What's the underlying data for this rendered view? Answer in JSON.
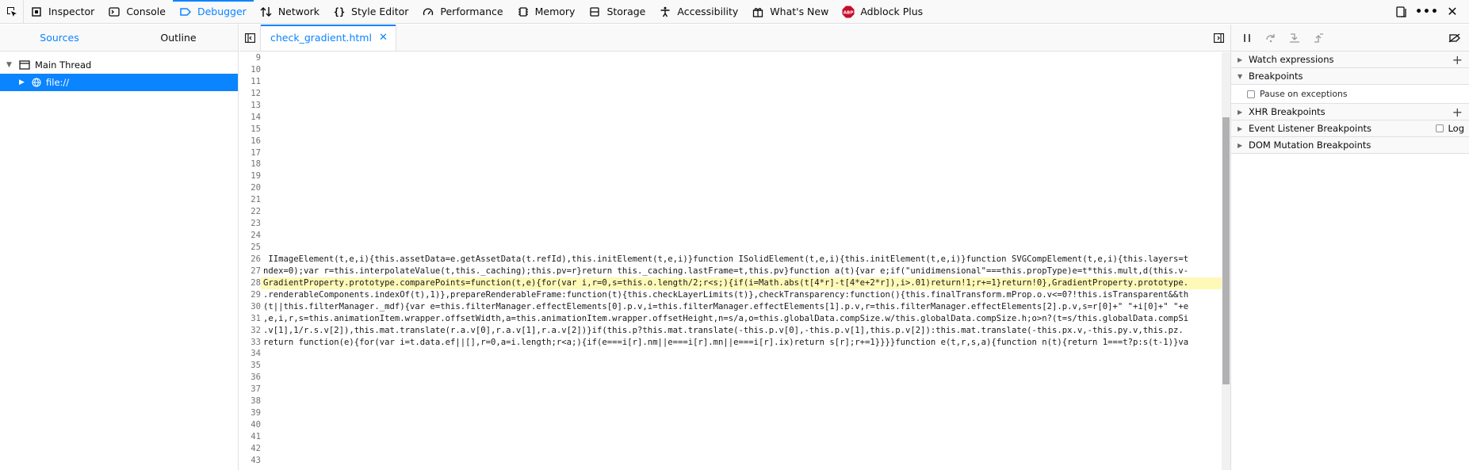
{
  "toolbar": {
    "tabs": [
      {
        "label": "Inspector",
        "icon": "inspector-icon"
      },
      {
        "label": "Console",
        "icon": "console-icon"
      },
      {
        "label": "Debugger",
        "icon": "debugger-icon"
      },
      {
        "label": "Network",
        "icon": "network-icon"
      },
      {
        "label": "Style Editor",
        "icon": "style-editor-icon"
      },
      {
        "label": "Performance",
        "icon": "performance-icon"
      },
      {
        "label": "Memory",
        "icon": "memory-icon"
      },
      {
        "label": "Storage",
        "icon": "storage-icon"
      },
      {
        "label": "Accessibility",
        "icon": "accessibility-icon"
      },
      {
        "label": "What's New",
        "icon": "whats-new-icon"
      },
      {
        "label": "Adblock Plus",
        "icon": "adblock-plus-icon"
      }
    ],
    "selected_tab": "Debugger",
    "accent_color": "#0a84ff"
  },
  "left_pane": {
    "tabs": [
      "Sources",
      "Outline"
    ],
    "selected_tab": "Sources",
    "tree": {
      "thread_label": "Main Thread",
      "item_label": "file://"
    }
  },
  "editor": {
    "file_tab": "check_gradient.html",
    "highlight_color": "#fff9b8",
    "lines": [
      {
        "n": "9",
        "text": ""
      },
      {
        "n": "10",
        "text": ""
      },
      {
        "n": "11",
        "text": ""
      },
      {
        "n": "12",
        "text": ""
      },
      {
        "n": "13",
        "text": ""
      },
      {
        "n": "14",
        "text": ""
      },
      {
        "n": "15",
        "text": ""
      },
      {
        "n": "16",
        "text": ""
      },
      {
        "n": "17",
        "text": ""
      },
      {
        "n": "18",
        "text": ""
      },
      {
        "n": "19",
        "text": ""
      },
      {
        "n": "20",
        "text": ""
      },
      {
        "n": "21",
        "text": ""
      },
      {
        "n": "22",
        "text": ""
      },
      {
        "n": "23",
        "text": ""
      },
      {
        "n": "24",
        "text": ""
      },
      {
        "n": "25",
        "text": ""
      },
      {
        "n": "26",
        "text": " IImageElement(t,e,i){this.assetData=e.getAssetData(t.refId),this.initElement(t,e,i)}function ISolidElement(t,e,i){this.initElement(t,e,i)}function SVGCompElement(t,e,i){this.layers=t"
      },
      {
        "n": "27",
        "text": "ndex=0);var r=this.interpolateValue(t,this._caching);this.pv=r}return this._caching.lastFrame=t,this.pv}function a(t){var e;if(\"unidimensional\"===this.propType)e=t*this.mult,d(this.v-"
      },
      {
        "n": "28",
        "text": "GradientProperty.prototype.comparePoints=function(t,e){for(var i,r=0,s=this.o.length/2;r<s;){if(i=Math.abs(t[4*r]-t[4*e+2*r]),i>.01)return!1;r+=1}return!0},GradientProperty.prototype.",
        "hl": true
      },
      {
        "n": "29",
        "text": ".renderableComponents.indexOf(t),1)},prepareRenderableFrame:function(t){this.checkLayerLimits(t)},checkTransparency:function(){this.finalTransform.mProp.o.v<=0?!this.isTransparent&&th"
      },
      {
        "n": "30",
        "text": "(t||this.filterManager._mdf){var e=this.filterManager.effectElements[0].p.v,i=this.filterManager.effectElements[1].p.v,r=this.filterManager.effectElements[2].p.v,s=r[0]+\" \"+i[0]+\" \"+e"
      },
      {
        "n": "31",
        "text": ",e,i,r,s=this.animationItem.wrapper.offsetWidth,a=this.animationItem.wrapper.offsetHeight,n=s/a,o=this.globalData.compSize.w/this.globalData.compSize.h;o>n?(t=s/this.globalData.compSi"
      },
      {
        "n": "32",
        "text": ".v[1],1/r.s.v[2]),this.mat.translate(r.a.v[0],r.a.v[1],r.a.v[2])}if(this.p?this.mat.translate(-this.p.v[0],-this.p.v[1],this.p.v[2]):this.mat.translate(-this.px.v,-this.py.v,this.pz."
      },
      {
        "n": "33",
        "text": "return function(e){for(var i=t.data.ef||[],r=0,a=i.length;r<a;){if(e===i[r].nm||e===i[r].mn||e===i[r].ix)return s[r];r+=1}}}}function e(t,r,s,a){function n(t){return 1===t?p:s(t-1)}va"
      },
      {
        "n": "34",
        "text": ""
      },
      {
        "n": "35",
        "text": ""
      },
      {
        "n": "36",
        "text": ""
      },
      {
        "n": "37",
        "text": ""
      },
      {
        "n": "38",
        "text": ""
      },
      {
        "n": "39",
        "text": ""
      },
      {
        "n": "40",
        "text": ""
      },
      {
        "n": "41",
        "text": ""
      },
      {
        "n": "42",
        "text": ""
      },
      {
        "n": "43",
        "text": ""
      }
    ]
  },
  "right_pane": {
    "sections": [
      {
        "label": "Watch expressions",
        "expanded": false,
        "action": "plus"
      },
      {
        "label": "Breakpoints",
        "expanded": true,
        "body": "Pause on exceptions"
      },
      {
        "label": "XHR Breakpoints",
        "expanded": false,
        "action": "plus"
      },
      {
        "label": "Event Listener Breakpoints",
        "expanded": false,
        "log_label": "Log"
      },
      {
        "label": "DOM Mutation Breakpoints",
        "expanded": false
      }
    ]
  }
}
